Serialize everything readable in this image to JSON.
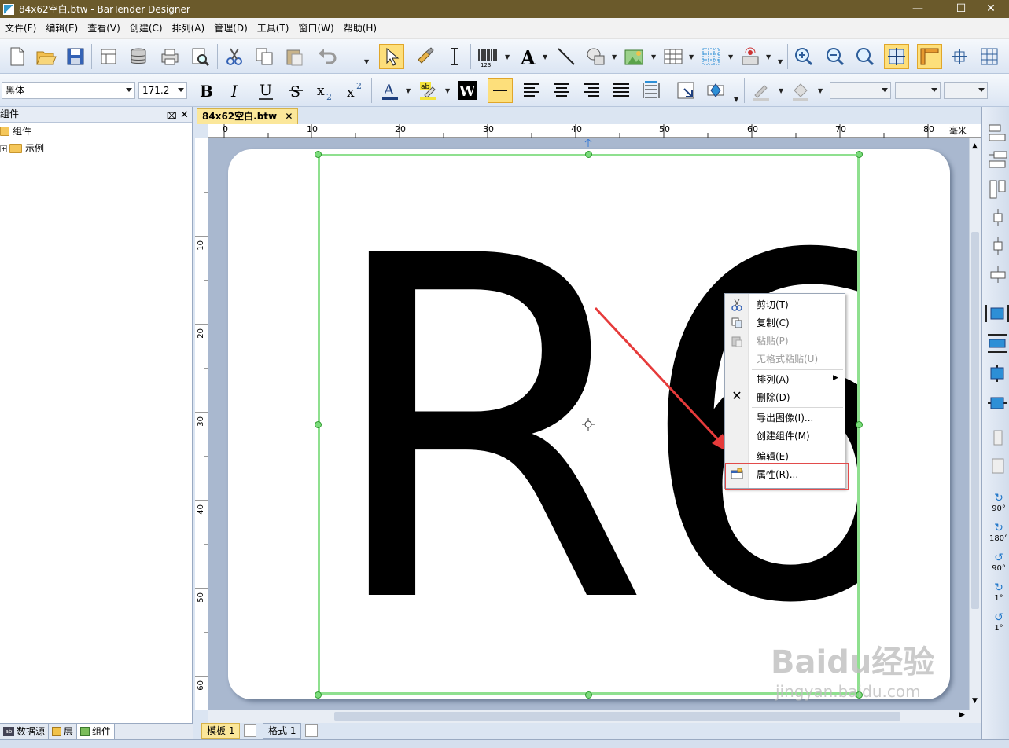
{
  "window": {
    "title": "84x62空白.btw - BarTender Designer"
  },
  "menubar": [
    {
      "label": "文件(F)"
    },
    {
      "label": "编辑(E)"
    },
    {
      "label": "查看(V)"
    },
    {
      "label": "创建(C)"
    },
    {
      "label": "排列(A)"
    },
    {
      "label": "管理(D)"
    },
    {
      "label": "工具(T)"
    },
    {
      "label": "窗口(W)"
    },
    {
      "label": "帮助(H)"
    }
  ],
  "format_toolbar": {
    "font_name": "黑体",
    "font_size": "171.2"
  },
  "left_panel": {
    "title": "组件",
    "tree": [
      {
        "label": "组件"
      },
      {
        "label": "示例"
      }
    ],
    "tabs": [
      {
        "label": "数据源"
      },
      {
        "label": "层"
      },
      {
        "label": "组件"
      }
    ]
  },
  "document": {
    "tab_label": "84x62空白.btw",
    "ruler_unit": "毫米",
    "ruler_h": [
      "0",
      "10",
      "20",
      "30",
      "40",
      "50",
      "60",
      "70",
      "80"
    ],
    "ruler_v": [
      "10",
      "20",
      "30",
      "40",
      "50",
      "60"
    ],
    "label_text": "R6",
    "bottom_tabs": [
      {
        "label": "模板 1"
      },
      {
        "label": "格式 1"
      }
    ]
  },
  "context_menu": {
    "items": [
      {
        "label": "剪切(T)",
        "enabled": true
      },
      {
        "label": "复制(C)",
        "enabled": true
      },
      {
        "label": "粘贴(P)",
        "enabled": false
      },
      {
        "label": "无格式粘贴(U)",
        "enabled": false
      },
      {
        "label": "排列(A)",
        "enabled": true
      },
      {
        "label": "删除(D)",
        "enabled": true
      },
      {
        "label": "导出图像(I)...",
        "enabled": true
      },
      {
        "label": "创建组件(M)",
        "enabled": true
      },
      {
        "label": "编辑(E)",
        "enabled": true
      },
      {
        "label": "属性(R)...",
        "enabled": true
      }
    ]
  },
  "right_toolbar": {
    "rotate": [
      "90°",
      "180°",
      "90°",
      "1°",
      "1°"
    ]
  },
  "watermark": {
    "text": "Baidu经验",
    "sub": "jingyan.baidu.com"
  },
  "colors": {
    "title_bar": "#6b5a2b",
    "selection": "#7bdc7b",
    "arrow": "#e63b3b",
    "highlight": "#e24b4b"
  }
}
